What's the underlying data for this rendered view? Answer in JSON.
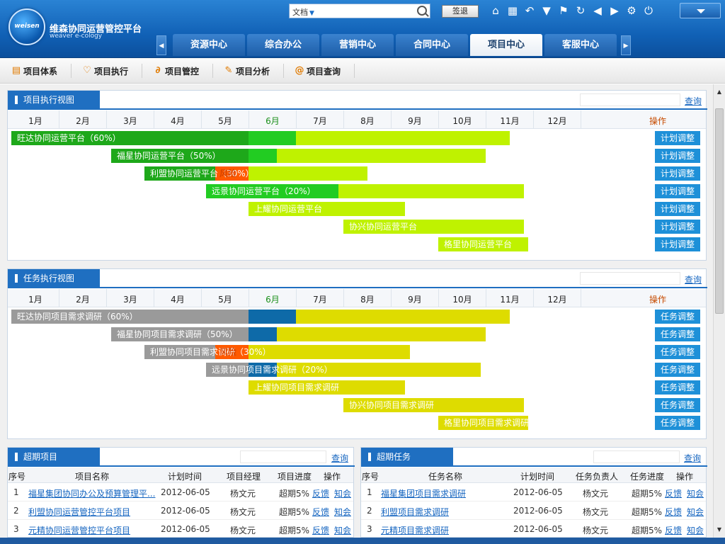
{
  "header": {
    "logo_text": "weisen",
    "brand_title": "维森协同运营管控平台",
    "brand_subtitle": "weaver e-cology",
    "search_type": "文档",
    "signin_label": "签退",
    "tool_icons": [
      "home-icon",
      "apps-icon",
      "undo-icon",
      "shirt-icon",
      "flag-icon",
      "refresh-icon",
      "back-icon",
      "forward-icon",
      "gear-icon",
      "power-icon"
    ]
  },
  "tabs": [
    {
      "label": "资源中心",
      "active": false
    },
    {
      "label": "综合办公",
      "active": false
    },
    {
      "label": "营销中心",
      "active": false
    },
    {
      "label": "合同中心",
      "active": false
    },
    {
      "label": "项目中心",
      "active": true
    },
    {
      "label": "客服中心",
      "active": false
    }
  ],
  "subnav": [
    "项目体系",
    "项目执行",
    "项目管控",
    "项目分析",
    "项目查询"
  ],
  "colors": {
    "accent": "#1f6fc1",
    "green_done": "#1ea81a",
    "green_now": "#22cc22",
    "green_plan": "#bff200",
    "risk": "#ff5a00",
    "gray_done": "#9a9a9a",
    "blue_now": "#0e6aa8",
    "yellow_plan": "#dedc00",
    "button": "#1e90d8"
  },
  "project_view": {
    "title": "项目执行视图",
    "query_label": "查询",
    "ops_label": "操作",
    "months": [
      "1月",
      "2月",
      "3月",
      "4月",
      "5月",
      "6月",
      "7月",
      "8月",
      "9月",
      "10月",
      "11月",
      "12月"
    ],
    "current_month": "6月",
    "button_label": "计划调整",
    "risk_label": "风险",
    "rows": [
      {
        "label": "旺达协同运营平台（60%）",
        "start": 1,
        "done": 6,
        "now": 7,
        "end": 11.5,
        "risk": false
      },
      {
        "label": "福星协同运营平台（50%）",
        "start": 3.1,
        "done": 6,
        "now": 6.6,
        "end": 11,
        "risk": false
      },
      {
        "label": "利盟协同运营平台（30%）",
        "start": 3.8,
        "done": 5.3,
        "now": 6,
        "end": 8.5,
        "risk": true
      },
      {
        "label": "远景协同运营平台（20%）",
        "start": 5.1,
        "done": 5.1,
        "now": 7.9,
        "end": 11.8,
        "risk": false
      },
      {
        "label": "上耀协同运营平台",
        "start": 6,
        "done": 6,
        "now": 6,
        "end": 9.3,
        "risk": false
      },
      {
        "label": "协兴协同运营平台",
        "start": 8,
        "done": 8,
        "now": 8,
        "end": 11.8,
        "risk": false
      },
      {
        "label": "格里协同运营平台",
        "start": 10,
        "done": 10,
        "now": 10,
        "end": 11.9,
        "risk": false
      }
    ]
  },
  "task_view": {
    "title": "任务执行视图",
    "query_label": "查询",
    "ops_label": "操作",
    "months": [
      "1月",
      "2月",
      "3月",
      "4月",
      "5月",
      "6月",
      "7月",
      "8月",
      "9月",
      "10月",
      "11月",
      "12月"
    ],
    "current_month": "6月",
    "button_label": "任务调整",
    "risk_label": "风险",
    "rows": [
      {
        "label": "旺达协同项目需求调研（60%）",
        "start": 1,
        "done": 6,
        "now": 7,
        "end": 11.5,
        "risk": false
      },
      {
        "label": "福星协同项目需求调研（50%）",
        "start": 3.1,
        "done": 6,
        "now": 6.6,
        "end": 11,
        "risk": false
      },
      {
        "label": "利盟协同项目需求调研（30%）",
        "start": 3.8,
        "done": 5.3,
        "now": 6,
        "end": 9.4,
        "risk": true
      },
      {
        "label": "远景协同项目需求调研（20%）",
        "start": 5.1,
        "done": 6,
        "now": 6.6,
        "end": 10.9,
        "risk": false
      },
      {
        "label": "上耀协同项目需求调研",
        "start": 6,
        "done": 6,
        "now": 6,
        "end": 9.3,
        "risk": false
      },
      {
        "label": "协兴协同项目需求调研",
        "start": 8,
        "done": 8,
        "now": 8,
        "end": 11.8,
        "risk": false
      },
      {
        "label": "格里协同项目需求调研",
        "start": 10,
        "done": 10,
        "now": 10,
        "end": 11.9,
        "risk": false
      }
    ]
  },
  "overdue_projects": {
    "title": "超期项目",
    "query_label": "查询",
    "headers": [
      "序号",
      "项目名称",
      "计划时间",
      "项目经理",
      "项目进度",
      "操作"
    ],
    "rows": [
      {
        "no": "1",
        "name": "福星集团协同办公及预算管理平...",
        "date": "2012-06-05",
        "owner": "杨文元",
        "progress": "超期5%",
        "op1": "反馈",
        "op2": "知会"
      },
      {
        "no": "2",
        "name": "利盟协同运营管控平台项目",
        "date": "2012-06-05",
        "owner": "杨文元",
        "progress": "超期5%",
        "op1": "反馈",
        "op2": "知会"
      },
      {
        "no": "3",
        "name": "元精协同运营管控平台项目",
        "date": "2012-06-05",
        "owner": "杨文元",
        "progress": "超期5%",
        "op1": "反馈",
        "op2": "知会"
      }
    ]
  },
  "overdue_tasks": {
    "title": "超期任务",
    "query_label": "查询",
    "headers": [
      "序号",
      "任务名称",
      "计划时间",
      "任务负责人",
      "任务进度",
      "操作"
    ],
    "rows": [
      {
        "no": "1",
        "name": "福星集团项目需求调研",
        "date": "2012-06-05",
        "owner": "杨文元",
        "progress": "超期5%",
        "op1": "反馈",
        "op2": "知会"
      },
      {
        "no": "2",
        "name": "利盟项目需求调研",
        "date": "2012-06-05",
        "owner": "杨文元",
        "progress": "超期5%",
        "op1": "反馈",
        "op2": "知会"
      },
      {
        "no": "3",
        "name": "元精项目需求调研",
        "date": "2012-06-05",
        "owner": "杨文元",
        "progress": "超期5%",
        "op1": "反馈",
        "op2": "知会"
      }
    ]
  }
}
